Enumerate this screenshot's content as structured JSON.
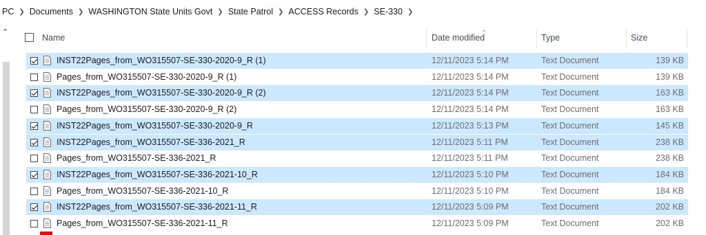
{
  "breadcrumb": [
    "PC",
    "Documents",
    "WASHINGTON State Units Govt",
    "State Patrol",
    "ACCESS Records",
    "SE-330"
  ],
  "columns": {
    "name": "Name",
    "date": "Date modified",
    "type": "Type",
    "size": "Size"
  },
  "rows": [
    {
      "name": "INST22Pages_from_WO315507-SE-330-2020-9_R (1)",
      "date": "12/11/2023 5:14 PM",
      "type": "Text Document",
      "size": "139 KB",
      "selected": true
    },
    {
      "name": "Pages_from_WO315507-SE-330-2020-9_R (1)",
      "date": "12/11/2023 5:14 PM",
      "type": "Text Document",
      "size": "139 KB",
      "selected": false
    },
    {
      "name": "INST22Pages_from_WO315507-SE-330-2020-9_R (2)",
      "date": "12/11/2023 5:14 PM",
      "type": "Text Document",
      "size": "163 KB",
      "selected": true
    },
    {
      "name": "Pages_from_WO315507-SE-330-2020-9_R (2)",
      "date": "12/11/2023 5:14 PM",
      "type": "Text Document",
      "size": "163 KB",
      "selected": false
    },
    {
      "name": "INST22Pages_from_WO315507-SE-330-2020-9_R",
      "date": "12/11/2023 5:13 PM",
      "type": "Text Document",
      "size": "145 KB",
      "selected": true
    },
    {
      "name": "INST22Pages_from_WO315507-SE-336-2021_R",
      "date": "12/11/2023 5:11 PM",
      "type": "Text Document",
      "size": "238 KB",
      "selected": true
    },
    {
      "name": "Pages_from_WO315507-SE-336-2021_R",
      "date": "12/11/2023 5:11 PM",
      "type": "Text Document",
      "size": "238 KB",
      "selected": false
    },
    {
      "name": "INST22Pages_from_WO315507-SE-336-2021-10_R",
      "date": "12/11/2023 5:10 PM",
      "type": "Text Document",
      "size": "184 KB",
      "selected": true
    },
    {
      "name": "Pages_from_WO315507-SE-336-2021-10_R",
      "date": "12/11/2023 5:10 PM",
      "type": "Text Document",
      "size": "184 KB",
      "selected": false
    },
    {
      "name": "INST22Pages_from_WO315507-SE-336-2021-11_R",
      "date": "12/11/2023 5:09 PM",
      "type": "Text Document",
      "size": "202 KB",
      "selected": true
    },
    {
      "name": "Pages_from_WO315507-SE-336-2021-11_R",
      "date": "12/11/2023 5:09 PM",
      "type": "Text Document",
      "size": "202 KB",
      "selected": false
    }
  ],
  "icons": {
    "separator": "chevron-right-icon",
    "file": "text-document-icon",
    "scroll_up": "scroll-up-arrow-icon",
    "sort": "sort-chevron-icon"
  },
  "colors": {
    "selection": "#cce8ff",
    "header_text": "#3d4b66",
    "secondary_text": "#6d6d6d"
  }
}
